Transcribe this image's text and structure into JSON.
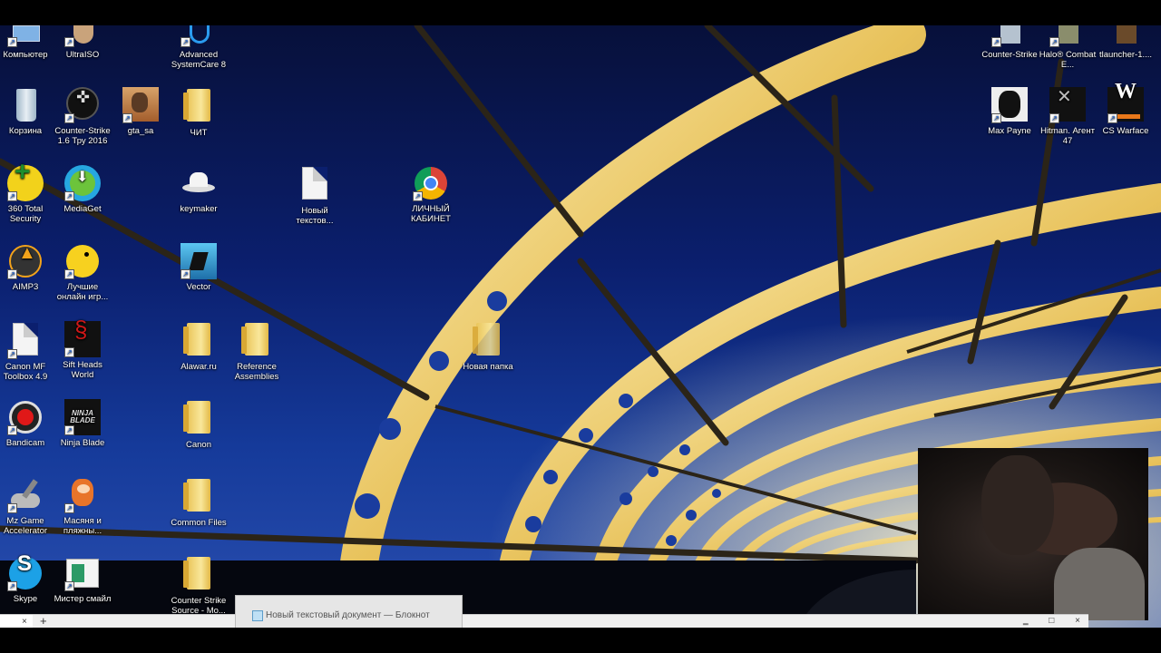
{
  "desktop_icons": [
    {
      "name": "computer",
      "label": "Компьютер"
    },
    {
      "name": "ultraiso",
      "label": "UltraISO"
    },
    {
      "name": "advanced-systemcare",
      "label": "Advanced SystemCare 8"
    },
    {
      "name": "counter-strike-top",
      "label": "Counter-Strike"
    },
    {
      "name": "halo",
      "label": "Halo® Combat E..."
    },
    {
      "name": "tlauncher",
      "label": "tlauncher-1...."
    },
    {
      "name": "recycle-bin",
      "label": "Корзина"
    },
    {
      "name": "cs16",
      "label": "Counter-Strike 1.6 Тру 2016"
    },
    {
      "name": "gta-sa",
      "label": "gta_sa"
    },
    {
      "name": "cheat-folder",
      "label": "ЧИТ"
    },
    {
      "name": "max-payne",
      "label": "Max Payne"
    },
    {
      "name": "hitman",
      "label": "Hitman. Агент 47"
    },
    {
      "name": "cs-warface",
      "label": "CS Warface"
    },
    {
      "name": "360-security",
      "label": "360 Total Security"
    },
    {
      "name": "mediaget",
      "label": "MediaGet"
    },
    {
      "name": "keymaker",
      "label": "keymaker"
    },
    {
      "name": "new-text-doc",
      "label": "Новый текстов..."
    },
    {
      "name": "personal-cabinet",
      "label": "ЛИЧНЫЙ КАБИНЕТ"
    },
    {
      "name": "aimp3",
      "label": "AIMP3"
    },
    {
      "name": "best-online-games",
      "label": "Лучшие онлайн игр..."
    },
    {
      "name": "vector",
      "label": "Vector"
    },
    {
      "name": "canon-mf-toolbox",
      "label": "Canon MF Toolbox 4.9"
    },
    {
      "name": "sift-heads",
      "label": "Sift Heads World"
    },
    {
      "name": "alawar-folder",
      "label": "Alawar.ru"
    },
    {
      "name": "reference-assemblies",
      "label": "Reference Assemblies"
    },
    {
      "name": "new-folder",
      "label": "Новая папка"
    },
    {
      "name": "bandicam",
      "label": "Bandicam"
    },
    {
      "name": "ninja-blade",
      "label": "Ninja Blade"
    },
    {
      "name": "canon-folder",
      "label": "Canon"
    },
    {
      "name": "mz-game-accelerator",
      "label": "Mz Game Accelerator"
    },
    {
      "name": "masyanya",
      "label": "Масяня и пляжны..."
    },
    {
      "name": "common-files",
      "label": "Common Files"
    },
    {
      "name": "skype",
      "label": "Skype"
    },
    {
      "name": "mister-smile",
      "label": "Мистер смайл"
    },
    {
      "name": "cs-source",
      "label": "Counter Strike Source - Mo..."
    }
  ],
  "ninja_blade_logo": "NINJA BLADE",
  "taskbar_preview": {
    "title": "Новый текстовый документ — Блокнот"
  },
  "notepad_tabs": {
    "close": "×",
    "new_tab": "+",
    "window_controls": "‗ □ ×"
  },
  "colors": {
    "sky_top": "#07103a",
    "sky_bottom": "#2a4fb0",
    "arch_gold": "#f5d77a",
    "folder": "#f0cf6a"
  }
}
